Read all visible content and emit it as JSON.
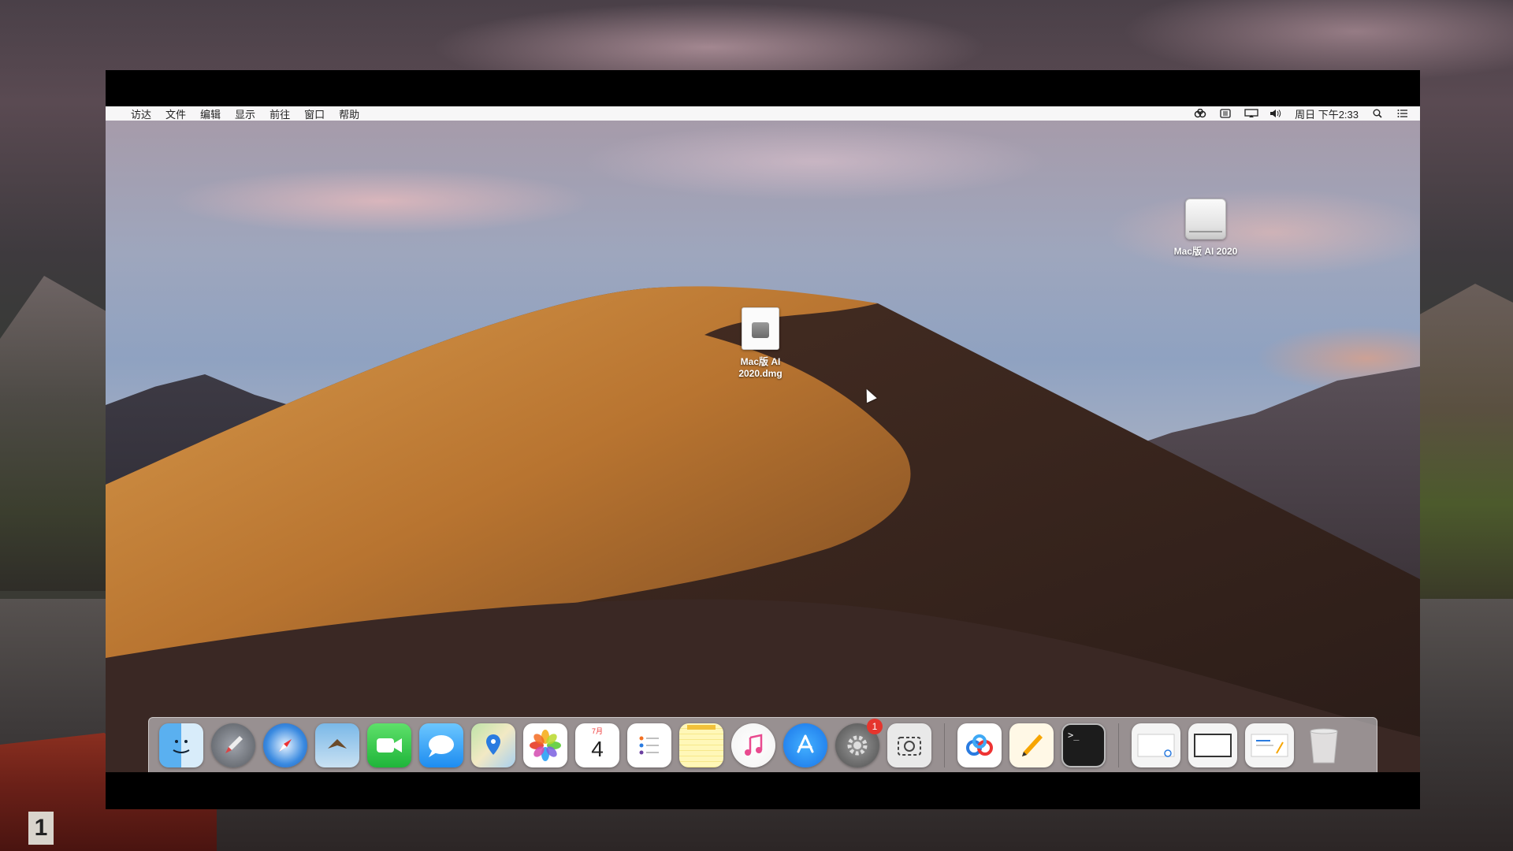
{
  "menubar": {
    "apple": "",
    "items": [
      "访达",
      "文件",
      "编辑",
      "显示",
      "前往",
      "窗口",
      "帮助"
    ],
    "datetime": "周日 下午2:33"
  },
  "desktop": {
    "dmg_icon_label_line1": "Mac版 AI",
    "dmg_icon_label_line2": "2020.dmg",
    "drive_icon_label": "Mac版 AI 2020"
  },
  "dock": {
    "calendar_month": "7月",
    "calendar_day": "4",
    "system_prefs_badge": "1",
    "terminal_prompt": ">_"
  },
  "outer": {
    "boat_number": "1"
  },
  "colors": {
    "dune_light": "#c8883a",
    "dune_dark": "#3a2620",
    "menubar_bg": "#fafafa",
    "badge_red": "#e5352d"
  }
}
